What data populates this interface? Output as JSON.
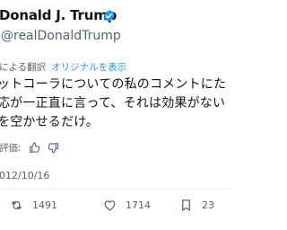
{
  "profile": {
    "display_name": "Donald J. Trump",
    "handle": "@realDonaldTrump",
    "verified_color": "#1d9bf0",
    "verified_icon": "verified-badge-icon"
  },
  "translation": {
    "translated_by": "による翻訳",
    "show_original": "オリジナルを表示"
  },
  "tweet": {
    "lines": [
      "ットコーラについての私のコメントにた",
      "応が一正直に言って、それは効果がない",
      "を空かせるだけ。"
    ]
  },
  "rating": {
    "label": "評価:",
    "icons": [
      "thumbs-up-icon",
      "thumbs-down-icon"
    ]
  },
  "timestamp": "012/10/16",
  "actions": {
    "retweets": "1491",
    "likes": "1714",
    "share_count": "23"
  },
  "colors": {
    "text": "#0f1419",
    "secondary": "#536471",
    "accent": "#1d9bf0"
  }
}
